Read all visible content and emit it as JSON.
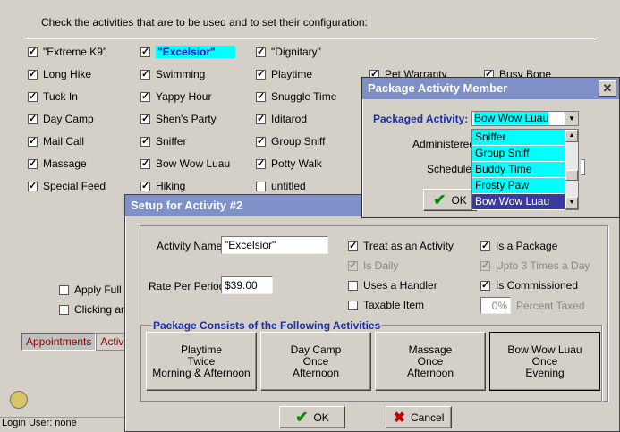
{
  "main": {
    "instruction": "Check the activities that are to be used and to set their configuration:",
    "activities": [
      {
        "label": "\"Extreme K9\"",
        "checked": true
      },
      {
        "label": "\"Excelsior\"",
        "checked": true
      },
      {
        "label": "\"Dignitary\"",
        "checked": true
      },
      {
        "label": "Long Hike",
        "checked": true
      },
      {
        "label": "Swimming",
        "checked": true
      },
      {
        "label": "Playtime",
        "checked": true
      },
      {
        "label": "Pet Warranty",
        "checked": true
      },
      {
        "label": "Busy Bone",
        "checked": true
      },
      {
        "label": "Tuck In",
        "checked": true
      },
      {
        "label": "Yappy Hour",
        "checked": true
      },
      {
        "label": "Snuggle Time",
        "checked": true
      },
      {
        "label": "Day Camp",
        "checked": true
      },
      {
        "label": "Shen's Party",
        "checked": true
      },
      {
        "label": "Iditarod",
        "checked": true
      },
      {
        "label": "Mail Call",
        "checked": true
      },
      {
        "label": "Sniffer",
        "checked": true
      },
      {
        "label": "Group Sniff",
        "checked": true
      },
      {
        "label": "Massage",
        "checked": true
      },
      {
        "label": "Bow Wow Luau",
        "checked": true
      },
      {
        "label": "Potty Walk",
        "checked": true
      },
      {
        "label": "Special Feed",
        "checked": true
      },
      {
        "label": "Hiking",
        "checked": true
      },
      {
        "label": "untitled",
        "checked": false
      }
    ],
    "apply_full": "Apply Full C",
    "clicking_an": "Clicking an",
    "tabs": [
      "Appointments",
      "Activiti"
    ],
    "status": "Login User: none"
  },
  "setup": {
    "title": "Setup for Activity #2",
    "name_label": "Activity Name:",
    "name_value": "\"Excelsior\"",
    "rate_label": "Rate Per Period:",
    "rate_value": "$39.00",
    "treat": "Treat as an Activity",
    "is_daily": "Is Daily",
    "uses_handler": "Uses a Handler",
    "taxable": "Taxable Item",
    "is_package": "Is a Package",
    "upto3": "Upto 3 Times a Day",
    "commissioned": "Is Commissioned",
    "percent_value": "0%",
    "percent_label": "Percent Taxed",
    "package_title": "Package Consists of the Following Activities",
    "packages": [
      "Playtime\nTwice\nMorning & Afternoon",
      "Day Camp\nOnce\nAfternoon",
      "Massage\nOnce\nAfternoon",
      "Bow Wow Luau\nOnce\nEvening"
    ],
    "ok": "OK",
    "cancel": "Cancel"
  },
  "pam": {
    "title": "Package Activity Member",
    "packaged_label": "Packaged Activity:",
    "selected": "Bow Wow Luau",
    "administered_label": "Administered:",
    "schedule_label": "Schedule:",
    "ok": "OK",
    "options": [
      "Sniffer",
      "Group Sniff",
      "Buddy Time",
      "Frosty Paw",
      "Bow Wow Luau"
    ]
  },
  "colors": {
    "title_bar": "#7f8fc8",
    "highlight": "#00ffff",
    "group_title": "#1a2fa8"
  }
}
